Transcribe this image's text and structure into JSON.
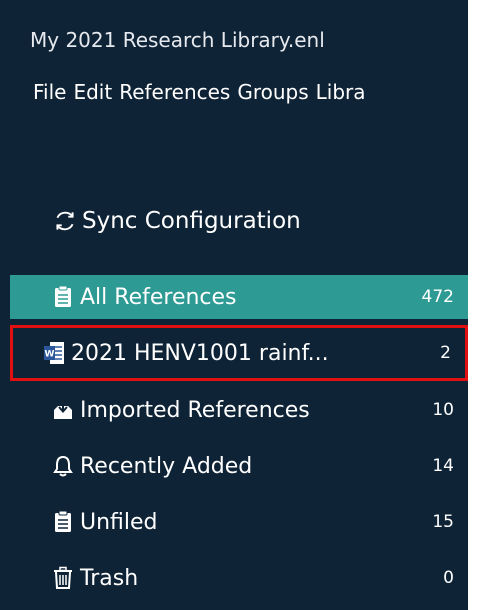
{
  "window": {
    "title": "My 2021 Research Library.enl"
  },
  "menu": {
    "items": [
      {
        "label": "File"
      },
      {
        "label": "Edit"
      },
      {
        "label": "References"
      },
      {
        "label": "Groups"
      },
      {
        "label": "Libra"
      }
    ]
  },
  "sidebar": {
    "sync_label": "Sync Configuration",
    "groups": [
      {
        "label": "All References",
        "count": "472",
        "icon": "clipboard-icon",
        "selected": true
      },
      {
        "label": "2021 HENV1001 rainf...",
        "count": "2",
        "icon": "word-document-icon",
        "highlighted": true
      },
      {
        "label": "Imported References",
        "count": "10",
        "icon": "import-icon"
      },
      {
        "label": "Recently Added",
        "count": "14",
        "icon": "bell-icon"
      },
      {
        "label": "Unfiled",
        "count": "15",
        "icon": "clipboard-icon"
      },
      {
        "label": "Trash",
        "count": "0",
        "icon": "trash-icon"
      }
    ]
  },
  "colors": {
    "background": "#0f2336",
    "selected": "#2e9a94",
    "highlight_border": "#e01010"
  }
}
